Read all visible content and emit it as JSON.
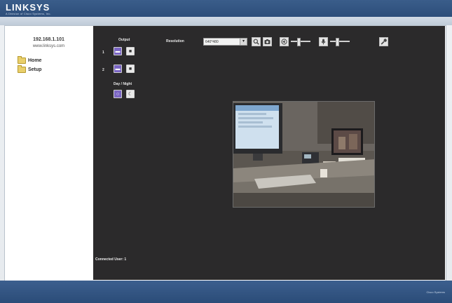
{
  "brand": {
    "logo": "LINKSYS",
    "tagline": "A Division of Cisco Systems, Inc."
  },
  "sidebar": {
    "ip": "192.168.1.101",
    "url": "www.linksys.com",
    "items": [
      {
        "label": "Home",
        "icon": "folder-icon"
      },
      {
        "label": "Setup",
        "icon": "folder-icon"
      }
    ]
  },
  "controls": {
    "output_title": "Output",
    "output_rows": [
      "1",
      "2"
    ],
    "day_night_title": "Day / Night",
    "resolution_label": "Resolution",
    "resolution_value": "640*480"
  },
  "status": {
    "connected_users": "Connected User: 1"
  },
  "footer": {
    "brand": "Cisco Systems"
  },
  "colors": {
    "accent": "#7a65c4",
    "panel": "#2b2a2b",
    "header": "#2d4e7a"
  }
}
